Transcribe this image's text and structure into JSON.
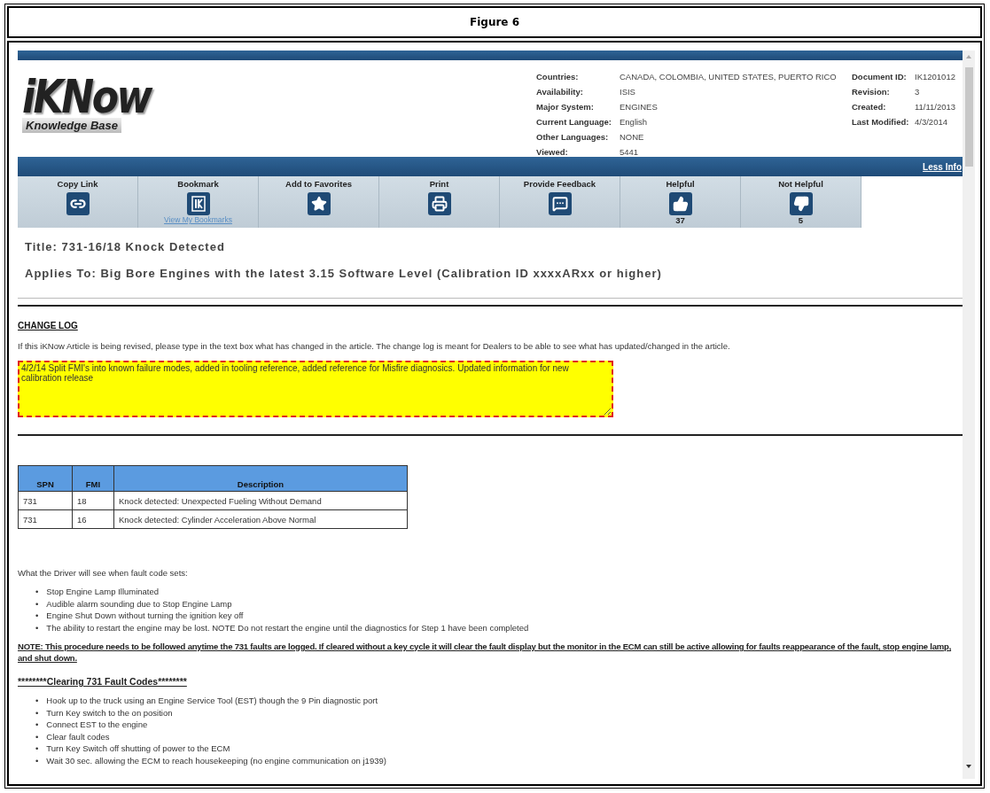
{
  "figure_caption": "Figure 6",
  "logo": {
    "brand": "iKNow",
    "tagline": "Knowledge Base"
  },
  "meta_left": [
    {
      "label": "Countries:",
      "value": "CANADA, COLOMBIA, UNITED STATES, PUERTO RICO"
    },
    {
      "label": "Availability:",
      "value": "ISIS"
    },
    {
      "label": "Major System:",
      "value": "ENGINES"
    },
    {
      "label": "Current Language:",
      "value": "English"
    },
    {
      "label": "Other Languages:",
      "value": "NONE"
    },
    {
      "label": "Viewed:",
      "value": "5441"
    }
  ],
  "meta_right": [
    {
      "label": "Document ID:",
      "value": "IK1201012"
    },
    {
      "label": "Revision:",
      "value": "3"
    },
    {
      "label": "Created:",
      "value": "11/11/2013"
    },
    {
      "label": "Last Modified:",
      "value": "4/3/2014"
    }
  ],
  "less_info_link": "Less Info",
  "toolbar": [
    {
      "label": "Copy Link",
      "kind": "link"
    },
    {
      "label": "Bookmark",
      "kind": "bookmark",
      "sublink": "View My Bookmarks"
    },
    {
      "label": "Add to Favorites",
      "kind": "star"
    },
    {
      "label": "Print",
      "kind": "printer"
    },
    {
      "label": "Provide Feedback",
      "kind": "feedback"
    },
    {
      "label": "Helpful",
      "kind": "thumbs-up",
      "count": "37"
    },
    {
      "label": "Not Helpful",
      "kind": "thumbs-down",
      "count": "5"
    }
  ],
  "title": {
    "label": "Title:",
    "value": "731-16/18 Knock Detected"
  },
  "applies_to": {
    "label": "Applies To:",
    "value": "Big Bore Engines with the latest 3.15 Software Level (Calibration ID xxxxARxx or higher)"
  },
  "change_log": {
    "heading": "CHANGE LOG",
    "description": "If this iKNow Article is being revised, please type in the text box what has changed in the article. The change log is meant for Dealers to be able to see what has updated/changed in the article.",
    "value": "4/2/14 Split FMI's into known failure modes, added in tooling reference, added reference for Misfire diagnosics. Updated information for new calibration release"
  },
  "table": {
    "columns": [
      "SPN",
      "FMI",
      "Description"
    ],
    "rows": [
      [
        "731",
        "18",
        "Knock detected: Unexpected Fueling Without Demand"
      ],
      [
        "731",
        "16",
        "Knock detected: Cylinder Acceleration Above Normal"
      ]
    ]
  },
  "driver_intro": "What the Driver will see when fault code sets:",
  "driver_items": [
    {
      "marker": "•",
      "text": "Stop Engine Lamp Illuminated"
    },
    {
      "marker": "•",
      "text": "Audible alarm sounding due to Stop Engine Lamp"
    },
    {
      "marker": "•",
      "text": "Engine Shut Down without turning the ignition key off"
    },
    {
      "marker": "•",
      "text": "The ability to restart the engine may be lost. NOTE Do not restart the engine until the diagnostics for Step 1 have been completed"
    }
  ],
  "note": "NOTE: This procedure needs to be followed anytime the 731 faults are logged. If cleared without a key cycle it will clear the fault display but the monitor in the ECM can still be active allowing for faults reappearance of the fault, stop engine lamp, and shut down.",
  "clearing_heading": "********Clearing 731 Fault Codes********",
  "clearing_steps": [
    {
      "marker": "•",
      "text": "Hook up to the truck using an Engine Service Tool (EST) though the 9 Pin diagnostic port"
    },
    {
      "marker": "•",
      "text": "Turn Key switch to the on position"
    },
    {
      "marker": "•",
      "text": "Connect EST to the engine"
    },
    {
      "marker": "•",
      "text": "Clear fault codes"
    },
    {
      "marker": "•",
      "text": "Turn Key Switch off shutting of power to the ECM"
    },
    {
      "marker": "•",
      "text": "Wait 30 sec. allowing the ECM to reach housekeeping (no engine communication on j1939)"
    }
  ]
}
